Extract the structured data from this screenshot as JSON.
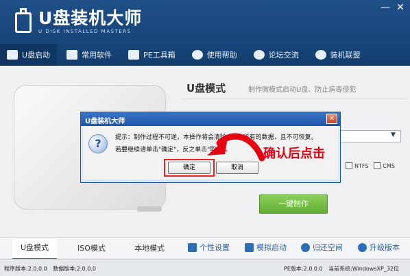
{
  "app": {
    "title": "U盘装机大师",
    "subtitle": "U DISK INSTALLED MASTERS"
  },
  "window": {
    "minimize_glyph": "—",
    "close_glyph": "✕"
  },
  "nav": {
    "items": [
      {
        "label": "U盘启动",
        "icon": "usb-icon"
      },
      {
        "label": "常用软件",
        "icon": "software-icon"
      },
      {
        "label": "PE工具箱",
        "icon": "toolbox-icon"
      },
      {
        "label": "使用帮助",
        "icon": "help-icon"
      },
      {
        "label": "论坛交流",
        "icon": "forum-icon"
      },
      {
        "label": "装机联盟",
        "icon": "alliance-icon"
      }
    ]
  },
  "mode": {
    "title": "U盘模式",
    "description": "制作微模式启动U盘、防止病毒侵犯"
  },
  "options": {
    "ntfs_label": "NTFS",
    "cms_label": "CMS"
  },
  "action": {
    "make_label": "一键制作"
  },
  "tabs": [
    {
      "label": "U盘模式"
    },
    {
      "label": "ISO模式"
    },
    {
      "label": "本地模式"
    }
  ],
  "tools": [
    {
      "label": "个性设置",
      "icon": "personalize-icon"
    },
    {
      "label": "模拟启动",
      "icon": "simulate-icon"
    },
    {
      "label": "归还空间",
      "icon": "restore-space-icon"
    },
    {
      "label": "升级版本",
      "icon": "upgrade-icon"
    }
  ],
  "status": {
    "program_version": "程序版本:2.0.0.0",
    "data_version": "数据版本:2.0.0.0",
    "pe_version": "PE版本:2.0.0.0",
    "system": "当前系统:WindowsXP_32位"
  },
  "dialog": {
    "title": "U盘装机大师",
    "close_glyph": "✕",
    "message_line1": "提示：制作过程不可逆，本操作将会清除U盘上所有的数据，且不可恢复。",
    "message_line2": "若要继续请单击\"确定\"，反之单击\"取消\"。",
    "ok_label": "确定",
    "cancel_label": "取消",
    "icon_glyph": "?"
  },
  "annotation": {
    "callout": "确认后点击",
    "color": "#e60012"
  }
}
